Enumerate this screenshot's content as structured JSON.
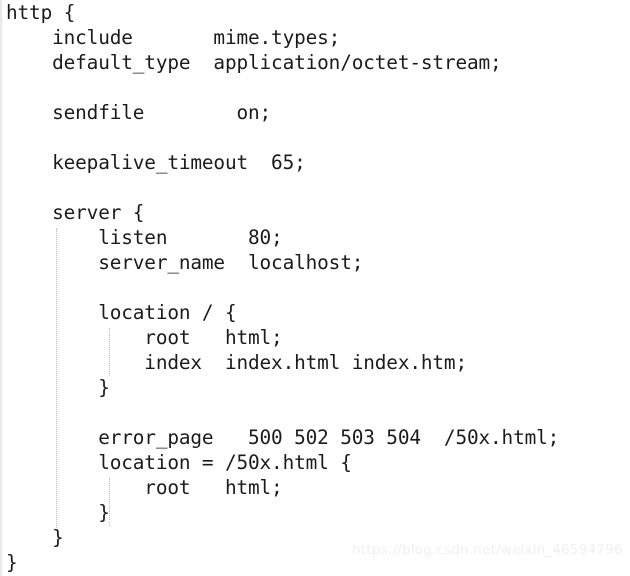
{
  "document": {
    "kind": "code-snippet",
    "language": "nginx",
    "background_color": "#ffffff",
    "text_color": "#1b1b1b",
    "guide_color": "#bdbdbd",
    "watermark_color": "#efefef"
  },
  "code": {
    "lines": [
      "http {",
      "    include       mime.types;",
      "    default_type  application/octet-stream;",
      "",
      "    sendfile        on;",
      "",
      "    keepalive_timeout  65;",
      "",
      "    server {",
      "        listen       80;",
      "        server_name  localhost;",
      "",
      "        location / {",
      "            root   html;",
      "            index  index.html index.htm;",
      "        }",
      "",
      "        error_page   500 502 503 504  /50x.html;",
      "        location = /50x.html {",
      "            root   html;",
      "        }",
      "    }",
      "}"
    ]
  },
  "watermark": {
    "text": "https://blog.csdn.net/weixin_46594796"
  }
}
